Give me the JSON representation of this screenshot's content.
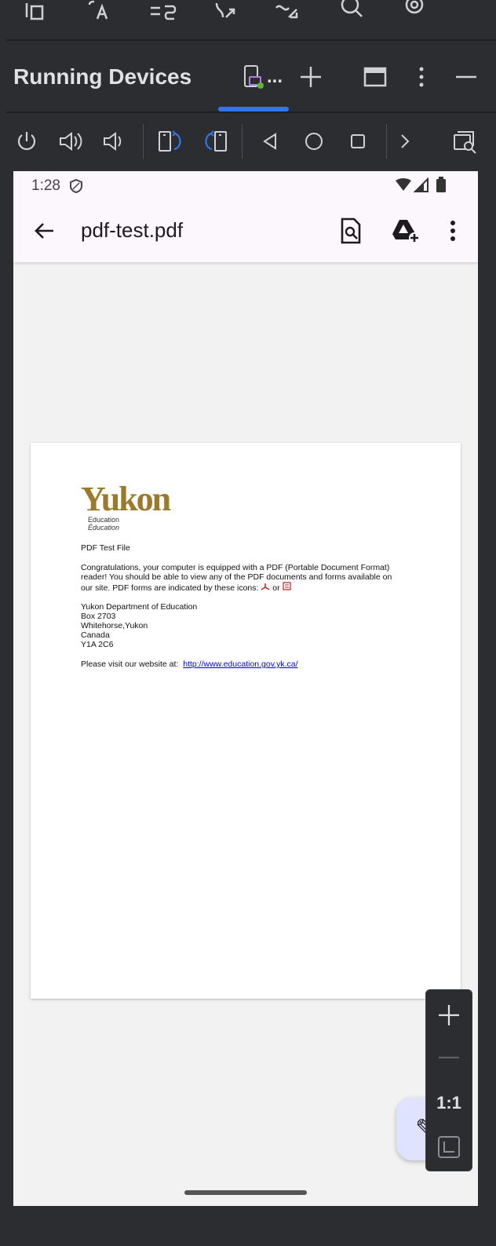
{
  "ide_top_toolbar": {
    "icons": [
      "layout-icon",
      "text-case-icon",
      "list-sort-icon",
      "branch-arrow-icon",
      "waveform-icon",
      "search-icon",
      "settings-icon"
    ]
  },
  "panel": {
    "title": "Running Devices",
    "tab_overflow": "...",
    "accent_color": "#3574f0"
  },
  "device_toolbar": {
    "icons": [
      "power-icon",
      "volume-up-icon",
      "volume-down-icon",
      "rotate-left-icon",
      "rotate-right-icon",
      "back-icon",
      "home-icon",
      "overview-icon",
      "more-icon",
      "screenshot-icon"
    ]
  },
  "phone": {
    "status_time": "1:28",
    "app_bar": {
      "title": "pdf-test.pdf"
    }
  },
  "pdf": {
    "logo_word": "Yukon",
    "logo_sub_en": "Education",
    "logo_sub_fr": "Éducation",
    "heading": "PDF Test File",
    "para_1": "Congratulations, your computer is equipped with a PDF (Portable Document Format)",
    "para_2": "reader!  You should be able to view any of the PDF documents and forms available on",
    "para_3": "our site.  PDF forms are indicated by these icons:",
    "para_3_or": "or",
    "addr_1": "Yukon Department of Education",
    "addr_2": "Box 2703",
    "addr_3": "Whitehorse,Yukon",
    "addr_4": "Canada",
    "addr_5": "Y1A 2C6",
    "visit": "Please visit our website at:",
    "link": "http://www.education.gov.yk.ca/",
    "logo_color": "#9a7a2c"
  },
  "zoom": {
    "ratio": "1:1"
  }
}
